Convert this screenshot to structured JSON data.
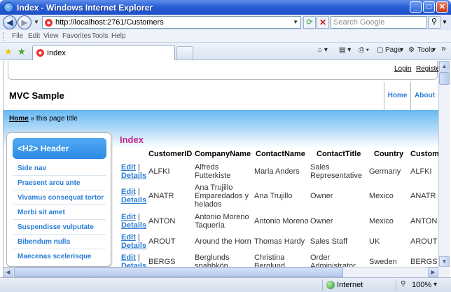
{
  "window": {
    "title": "Index - Windows Internet Explorer"
  },
  "address": {
    "url": "http://localhost:2761/Customers",
    "search_placeholder": "Search Google"
  },
  "menu": [
    "File",
    "Edit",
    "View",
    "Favorites",
    "Tools",
    "Help"
  ],
  "tab": {
    "label": "Index"
  },
  "toolbar": {
    "page": "Page",
    "tools": "Tools",
    "more": "»"
  },
  "status": {
    "zone": "Internet",
    "zoom": "100%"
  },
  "site": {
    "login": "Login",
    "register": "Register",
    "title": "MVC Sample",
    "nav": [
      "Home",
      "About"
    ],
    "breadcrumb_home": "Home",
    "breadcrumb_rest": " » this page title"
  },
  "sidebar": {
    "header": "<H2> Header",
    "links": [
      "Side nav",
      "Praesent arcu ante",
      "Vivamus consequat tortor",
      "Morbi sit amet",
      "Suspendisse vulputate",
      "Bibendum nulla",
      "Maecenas scelerisque"
    ]
  },
  "main": {
    "heading": "Index",
    "edit_label": "Edit",
    "details_label": "Details",
    "columns": [
      "CustomerID",
      "CompanyName",
      "ContactName",
      "ContactTitle",
      "Country",
      "Custom"
    ],
    "rows": [
      {
        "id": "ALFKI",
        "company": [
          "Alfreds",
          "Futterkiste"
        ],
        "contact": [
          "Maria Anders"
        ],
        "title": [
          "Sales",
          "Representative"
        ],
        "country": "Germany",
        "extra": "ALFKI"
      },
      {
        "id": "ANATR",
        "company": [
          "Ana Trujillo",
          "Emparedados y",
          "helados"
        ],
        "contact": [
          "Ana Trujillo"
        ],
        "title": [
          "Owner"
        ],
        "country": "Mexico",
        "extra": "ANATR"
      },
      {
        "id": "ANTON",
        "company": [
          "Antonio Moreno",
          "Taquería"
        ],
        "contact": [
          "Antonio Moreno"
        ],
        "title": [
          "Owner"
        ],
        "country": "Mexico",
        "extra": "ANTON"
      },
      {
        "id": "AROUT",
        "company": [
          "Around the Horn"
        ],
        "contact": [
          "Thomas Hardy"
        ],
        "title": [
          "Sales Staff"
        ],
        "country": "UK",
        "extra": "AROUT"
      },
      {
        "id": "BERGS",
        "company": [
          "Berglunds",
          "snabbköp"
        ],
        "contact": [
          "Christina",
          "Berglund"
        ],
        "title": [
          "Order",
          "Administrator"
        ],
        "country": "Sweden",
        "extra": "BERGS"
      }
    ]
  }
}
